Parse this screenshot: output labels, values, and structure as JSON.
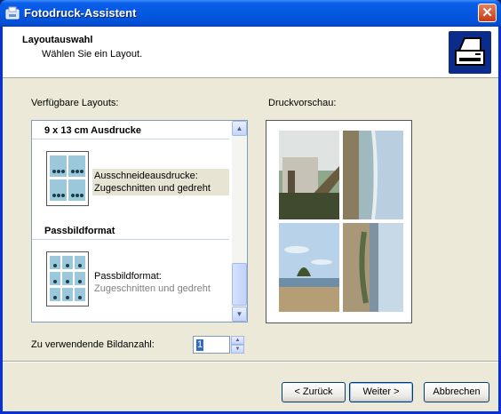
{
  "window": {
    "title": "Fotodruck-Assistent"
  },
  "header": {
    "title": "Layoutauswahl",
    "subtitle": "Wählen Sie ein Layout."
  },
  "layouts": {
    "label": "Verfügbare Layouts:",
    "groups": [
      {
        "heading": "9 x 13 cm Ausdrucke",
        "item_line1": "Ausschneideausdrucke:",
        "item_line2": "Zugeschnitten und gedreht",
        "selected": true
      },
      {
        "heading": "Passbildformat",
        "item_line1": "Passbildformat:",
        "item_line2": "Zugeschnitten und gedreht",
        "selected": false
      }
    ]
  },
  "preview": {
    "label": "Druckvorschau:"
  },
  "count": {
    "label": "Zu verwendende Bildanzahl:",
    "value": "1"
  },
  "buttons": {
    "back": "< Zurück",
    "next": "Weiter >",
    "cancel": "Abbrechen"
  },
  "icons": [
    "app-icon",
    "close-icon",
    "printer-icon",
    "scroll-up-icon",
    "scroll-down-icon",
    "spin-up-icon",
    "spin-down-icon"
  ],
  "colors": {
    "titlebar": "#0558e0",
    "dialog_bg": "#ece9d8",
    "selection": "#316ac5"
  }
}
